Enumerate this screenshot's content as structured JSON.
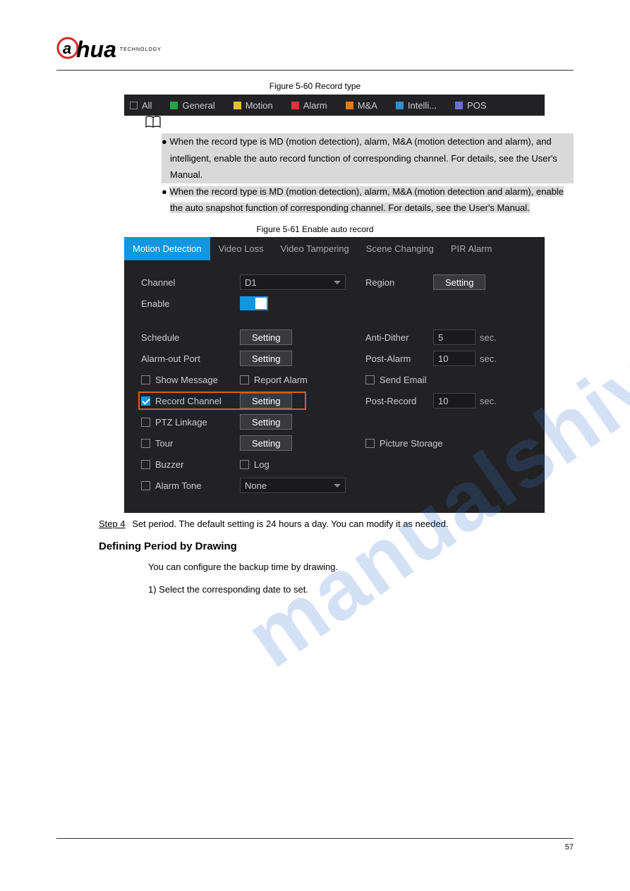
{
  "logo": {
    "brand_first": "a",
    "brand_rest": "hua",
    "tagline": "TECHNOLOGY"
  },
  "figure1_label": "Figure 5-60 Record type",
  "event_types": {
    "all": "All",
    "general": "General",
    "motion": "Motion",
    "alarm": "Alarm",
    "ma": "M&A",
    "intelli": "Intelli...",
    "pos": "POS"
  },
  "note": {
    "li1": "When the record type is MD (motion detection), alarm, M&A (motion detection and alarm), and intelligent, enable the auto record function of corresponding channel. For details, see the User's Manual.",
    "li2": "When the record type is MD (motion detection), alarm, M&A (motion detection and alarm), enable the auto snapshot function of corresponding channel. For details, see the User's Manual."
  },
  "figure2_label": "Figure 5-61 Enable auto record",
  "tabs": {
    "t1": "Motion Detection",
    "t2": "Video Loss",
    "t3": "Video Tampering",
    "t4": "Scene Changing",
    "t5": "PIR Alarm"
  },
  "form": {
    "channel": "Channel",
    "channel_val": "D1",
    "enable": "Enable",
    "region": "Region",
    "schedule": "Schedule",
    "alarm_out": "Alarm-out Port",
    "anti_dither": "Anti-Dither",
    "anti_dither_val": "5",
    "post_alarm": "Post-Alarm",
    "post_alarm_val": "10",
    "show_message": "Show Message",
    "report_alarm": "Report Alarm",
    "send_email": "Send Email",
    "record_channel": "Record Channel",
    "post_record": "Post-Record",
    "post_record_val": "10",
    "ptz_linkage": "PTZ Linkage",
    "tour": "Tour",
    "picture_storage": "Picture Storage",
    "buzzer": "Buzzer",
    "log": "Log",
    "alarm_tone": "Alarm Tone",
    "alarm_tone_val": "None",
    "setting": "Setting",
    "sec": "sec."
  },
  "step": {
    "s4": "Step 4",
    "s4_text": "Set period. The default setting is 24 hours a day. You can modify it as needed."
  },
  "section": {
    "title": "Defining Period by Drawing",
    "intro": "You can configure the backup time by drawing.",
    "li1": "1) Select the corresponding date to set."
  },
  "watermark": "manualshive.com",
  "footer": {
    "page": "57"
  }
}
